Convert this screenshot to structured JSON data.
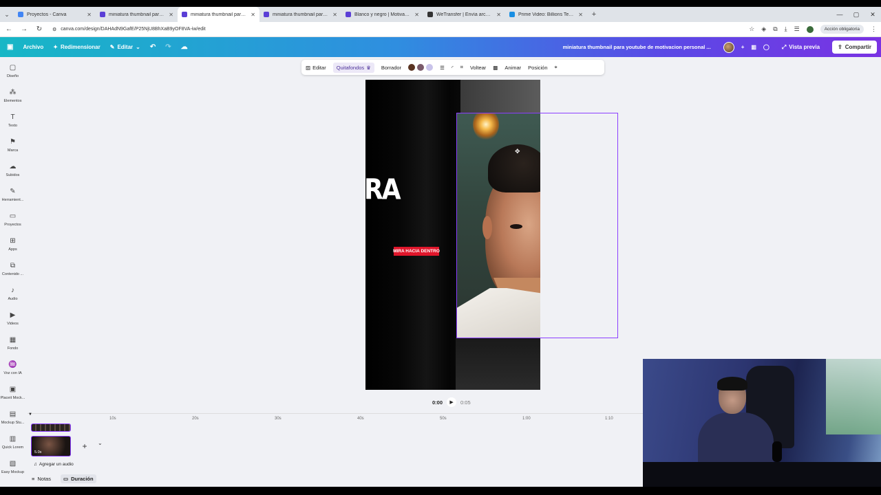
{
  "browser": {
    "tabs": [
      {
        "label": "Proyectos - Canva",
        "color": "#4285f4",
        "active": false
      },
      {
        "label": "miniatura thumbnail para youtube",
        "color": "#5b3fd6",
        "active": false
      },
      {
        "label": "miniatura thumbnail para youtube",
        "color": "#5b3fd6",
        "active": true
      },
      {
        "label": "miniatura thumbnail para youtube",
        "color": "#5b3fd6",
        "active": false
      },
      {
        "label": "Blanco y negro | Motivacional | ...",
        "color": "#5b3fd6",
        "active": false
      },
      {
        "label": "WeTransfer | Envía archivos gra...",
        "color": "#333333",
        "active": false
      },
      {
        "label": "Prime Video: Billions Temporada",
        "color": "#1a8fe3",
        "active": false
      }
    ],
    "url": "canva.com/design/DAHAdN9GafE/P25NjU8BhXaB9yOF8VA-iw/edit",
    "accion_label": "Acción obligatoria"
  },
  "canva_header": {
    "archivo": "Archivo",
    "redimensionar": "Redimensionar",
    "editar": "Editar",
    "title": "miniatura thumbnail para youtube de motivacion personal ...",
    "vista_previa": "Vista previa",
    "compartir": "Compartir"
  },
  "sidebar": {
    "items": [
      {
        "label": "Diseño",
        "icon": "layout-icon"
      },
      {
        "label": "Elementos",
        "icon": "elements-icon"
      },
      {
        "label": "Texto",
        "icon": "text-icon"
      },
      {
        "label": "Marca",
        "icon": "brand-icon"
      },
      {
        "label": "Subidos",
        "icon": "upload-icon"
      },
      {
        "label": "Herramient...",
        "icon": "tools-icon"
      },
      {
        "label": "Proyectos",
        "icon": "folder-icon"
      },
      {
        "label": "Apps",
        "icon": "apps-icon"
      },
      {
        "label": "Contenido ...",
        "icon": "content-icon"
      },
      {
        "label": "Audio",
        "icon": "audio-icon"
      },
      {
        "label": "Videos",
        "icon": "video-icon"
      },
      {
        "label": "Fondo",
        "icon": "background-icon"
      },
      {
        "label": "Voz con IA",
        "icon": "voice-icon"
      },
      {
        "label": "Placeit Mock...",
        "icon": "placeit-icon"
      },
      {
        "label": "Mockup Stu...",
        "icon": "mockup-icon"
      },
      {
        "label": "Quick Lorem",
        "icon": "lorem-icon"
      },
      {
        "label": "Easy Mockup",
        "icon": "easy-mockup-icon"
      }
    ]
  },
  "toolbar": {
    "editar": "Editar",
    "quitafondos": "Quitafondos",
    "borrador": "Borrador",
    "swatches": [
      "#5a3422",
      "#7a5a6a",
      "#c9c3ea"
    ],
    "voltear": "Voltear",
    "animar": "Animar",
    "posicion": "Posición"
  },
  "canvas": {
    "big_text": "RA",
    "banner_text": "MIRA HACIA DENTRO"
  },
  "playback": {
    "current": "0:00",
    "duration": "0:05"
  },
  "timeline": {
    "ticks": [
      "10s",
      "20s",
      "30s",
      "40s",
      "50s",
      "1:00",
      "1:10"
    ],
    "clip_label": "5.0s",
    "add_audio": "Agregar un audio"
  },
  "bottom": {
    "notas": "Notas",
    "duracion": "Duración"
  }
}
